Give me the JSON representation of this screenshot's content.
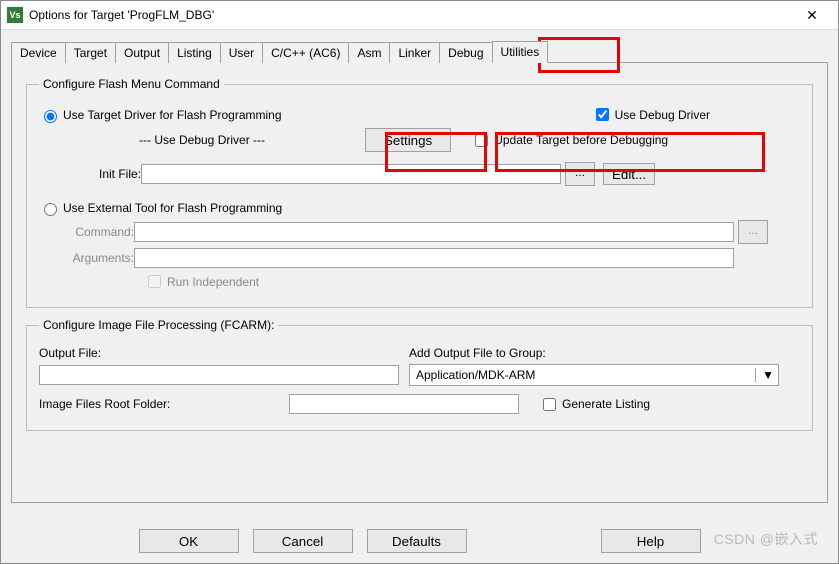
{
  "window": {
    "title": "Options for Target 'ProgFLM_DBG'",
    "close_glyph": "✕",
    "icon_text": "Vs"
  },
  "tabs": [
    "Device",
    "Target",
    "Output",
    "Listing",
    "User",
    "C/C++ (AC6)",
    "Asm",
    "Linker",
    "Debug",
    "Utilities"
  ],
  "active_tab": "Utilities",
  "group1": {
    "legend": "Configure Flash Menu Command",
    "radio1": "Use Target Driver for Flash Programming",
    "debug_driver_sep": "--- Use Debug Driver ---",
    "settings_btn": "Settings",
    "use_debug_driver": "Use Debug Driver",
    "update_target": "Update Target before Debugging",
    "init_file_label": "Init File:",
    "init_file_value": "",
    "edit_btn": "Edit...",
    "radio2": "Use External Tool for Flash Programming",
    "command_label": "Command:",
    "command_value": "",
    "arguments_label": "Arguments:",
    "arguments_value": "",
    "run_independent": "Run Independent"
  },
  "group2": {
    "legend": "Configure Image File Processing (FCARM):",
    "output_file_label": "Output File:",
    "output_file_value": "",
    "add_to_group_label": "Add Output File  to Group:",
    "group_selected": "Application/MDK-ARM",
    "root_label": "Image Files Root Folder:",
    "root_value": "",
    "generate_listing": "Generate Listing"
  },
  "buttons": {
    "ok": "OK",
    "cancel": "Cancel",
    "defaults": "Defaults",
    "help": "Help"
  },
  "watermark": "CSDN @嵌入式",
  "glyphs": {
    "browse": "...",
    "dropdown": "▼"
  }
}
